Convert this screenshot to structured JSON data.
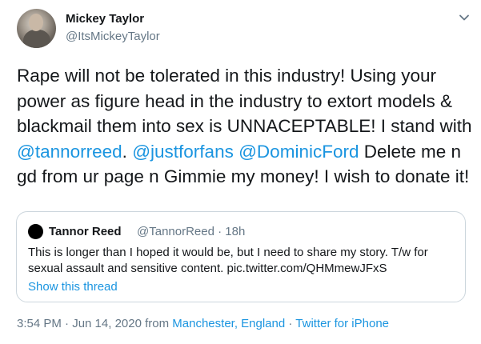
{
  "author": {
    "display_name": "Mickey Taylor",
    "handle": "@ItsMickeyTaylor"
  },
  "tweet": {
    "segments": [
      {
        "text": "Rape will not be tolerated in this industry! Using your power as figure head in the industry to extort models & blackmail them into sex is UNNACEPTABLE! I stand with ",
        "type": "text"
      },
      {
        "text": "@tannorreed",
        "type": "mention"
      },
      {
        "text": ". ",
        "type": "text"
      },
      {
        "text": "@justforfans",
        "type": "mention"
      },
      {
        "text": " ",
        "type": "text"
      },
      {
        "text": "@DominicFord",
        "type": "mention"
      },
      {
        "text": " Delete me n gd from ur page n Gimmie my money! I wish to donate it!",
        "type": "text"
      }
    ]
  },
  "quoted_tweet": {
    "display_name": "Tannor Reed",
    "handle": "@TannorReed",
    "separator": "·",
    "time": "18h",
    "text": "This is longer than I hoped it would be, but I need to share my story. T/w for sexual assault and sensitive content. pic.twitter.com/QHMmewJFxS",
    "show_thread_label": "Show this thread"
  },
  "footer": {
    "timestamp": "3:54 PM · Jun 14, 2020 from ",
    "location": "Manchester, England",
    "separator": " · ",
    "source": "Twitter for iPhone"
  },
  "icons": {
    "menu": "chevron-down-icon"
  },
  "colors": {
    "link": "#1b95e0",
    "secondary_text": "#657786",
    "primary_text": "#14171a",
    "border": "#ccd6dd"
  }
}
